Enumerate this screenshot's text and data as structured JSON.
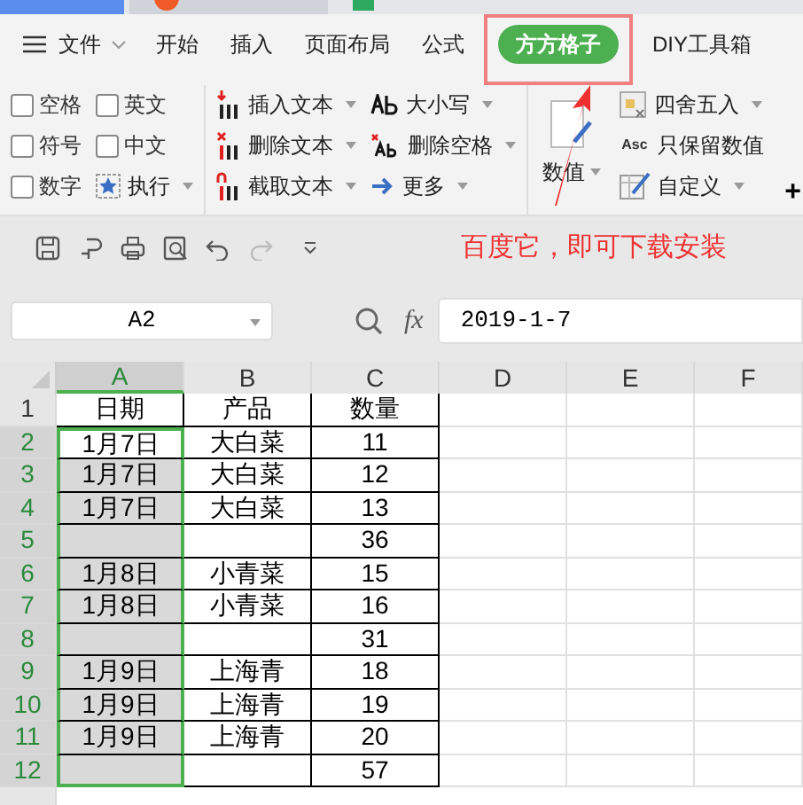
{
  "menu_tabs": [
    {
      "label": "文件",
      "kind": "file",
      "selected": false
    },
    {
      "label": "开始",
      "kind": "tab",
      "selected": false
    },
    {
      "label": "插入",
      "kind": "tab",
      "selected": false
    },
    {
      "label": "页面布局",
      "kind": "tab",
      "selected": false
    },
    {
      "label": "公式",
      "kind": "tab",
      "selected": false
    },
    {
      "label": "方方格子",
      "kind": "tab",
      "selected": true
    },
    {
      "label": "DIY工具箱",
      "kind": "tab",
      "selected": false
    }
  ],
  "ribbon": [
    {
      "columns": [
        [
          {
            "kind": "checkbox",
            "label": "空格",
            "checked": false
          },
          {
            "kind": "checkbox",
            "label": "符号",
            "checked": false
          },
          {
            "kind": "checkbox",
            "label": "数字",
            "checked": false
          }
        ],
        [
          {
            "kind": "checkbox",
            "label": "英文",
            "checked": false
          },
          {
            "kind": "checkbox",
            "label": "中文",
            "checked": false
          },
          {
            "kind": "command",
            "label": "执行",
            "dropdown": true
          }
        ]
      ]
    },
    {
      "columns": [
        [
          {
            "kind": "command",
            "label": "插入文本",
            "dropdown": true
          },
          {
            "kind": "command",
            "label": "删除文本",
            "dropdown": true
          },
          {
            "kind": "command",
            "label": "截取文本",
            "dropdown": true
          }
        ],
        [
          {
            "kind": "command",
            "label": "大小写",
            "dropdown": true
          },
          {
            "kind": "command",
            "label": "删除空格",
            "dropdown": true
          },
          {
            "kind": "command",
            "label": "更多",
            "dropdown": true
          }
        ]
      ]
    },
    {
      "columns": [
        [
          {
            "kind": "big",
            "label": "数值",
            "dropdown": true
          }
        ],
        [
          {
            "kind": "command",
            "label": "四舍五入",
            "dropdown": true
          },
          {
            "kind": "command",
            "badge": "Asc",
            "label": "只保留数值",
            "dropdown": false
          },
          {
            "kind": "command",
            "label": "自定义",
            "dropdown": true
          },
          {
            "kind": "plus",
            "label": "+"
          }
        ]
      ]
    }
  ],
  "annotation": {
    "text": "百度它，即可下载安装"
  },
  "name_box": {
    "value": "A2"
  },
  "formula": {
    "label": "fx",
    "value": "2019-1-7"
  },
  "columns": [
    {
      "label": "A",
      "selected": true
    },
    {
      "label": "B",
      "selected": false
    },
    {
      "label": "C",
      "selected": false
    },
    {
      "label": "D",
      "selected": false
    },
    {
      "label": "E",
      "selected": false
    },
    {
      "label": "F",
      "selected": false
    }
  ],
  "rows": [
    {
      "header": "1",
      "selected": false,
      "active": false,
      "cells": [
        "日期",
        "产品",
        "数量"
      ]
    },
    {
      "header": "2",
      "selected": true,
      "active": true,
      "cells": [
        "1月7日",
        "大白菜",
        "11"
      ]
    },
    {
      "header": "3",
      "selected": true,
      "active": false,
      "cells": [
        "1月7日",
        "大白菜",
        "12"
      ]
    },
    {
      "header": "4",
      "selected": true,
      "active": false,
      "cells": [
        "1月7日",
        "大白菜",
        "13"
      ]
    },
    {
      "header": "5",
      "selected": true,
      "active": false,
      "cells": [
        "",
        "",
        "36"
      ]
    },
    {
      "header": "6",
      "selected": true,
      "active": false,
      "cells": [
        "1月8日",
        "小青菜",
        "15"
      ]
    },
    {
      "header": "7",
      "selected": true,
      "active": false,
      "cells": [
        "1月8日",
        "小青菜",
        "16"
      ]
    },
    {
      "header": "8",
      "selected": true,
      "active": false,
      "cells": [
        "",
        "",
        "31"
      ]
    },
    {
      "header": "9",
      "selected": true,
      "active": false,
      "cells": [
        "1月9日",
        "上海青",
        "18"
      ]
    },
    {
      "header": "10",
      "selected": true,
      "active": false,
      "cells": [
        "1月9日",
        "上海青",
        "19"
      ]
    },
    {
      "header": "11",
      "selected": true,
      "active": false,
      "cells": [
        "1月9日",
        "上海青",
        "20"
      ]
    },
    {
      "header": "12",
      "selected": true,
      "active": false,
      "cells": [
        "",
        "",
        "57"
      ]
    }
  ]
}
